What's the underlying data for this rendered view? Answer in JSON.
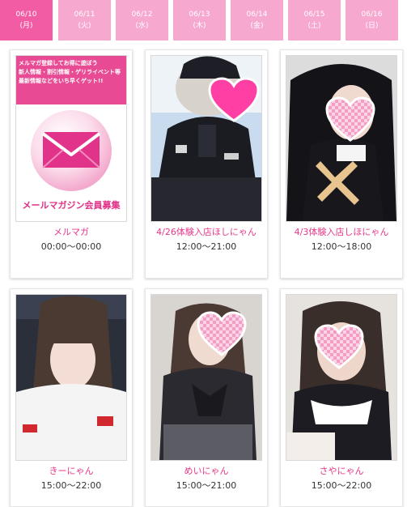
{
  "schedule_tabs": [
    {
      "date": "06/10",
      "weekday": "(月)"
    },
    {
      "date": "06/11",
      "weekday": "(火)"
    },
    {
      "date": "06/12",
      "weekday": "(水)"
    },
    {
      "date": "06/13",
      "weekday": "(木)"
    },
    {
      "date": "06/14",
      "weekday": "(金)"
    },
    {
      "date": "06/15",
      "weekday": "(土)"
    },
    {
      "date": "06/16",
      "weekday": "(日)"
    }
  ],
  "active_tab": "06/10",
  "banner": {
    "line1": "メルマガ登録してお得に遊ぼう",
    "line2": "新人情報・割引情報・ゲリライベント等",
    "line3": "最新情報などをいち早くゲット!!",
    "footer": "メールマガジン会員募集"
  },
  "cards": [
    {
      "name": "メルマガ",
      "time": "00:00〜00:00",
      "image": "mail-magazine-banner"
    },
    {
      "name": "4/26体験入店ほしにゃん",
      "time": "12:00〜21:00",
      "image": "photo-police-costume"
    },
    {
      "name": "4/3体験入店しほにゃん",
      "time": "12:00〜18:00",
      "image": "photo-nun-costume"
    },
    {
      "name": "きーにゃん",
      "time": "15:00〜22:00",
      "image": "photo-white-jacket"
    },
    {
      "name": "めいにゃん",
      "time": "15:00〜21:00",
      "image": "photo-school-uniform"
    },
    {
      "name": "さやにゃん",
      "time": "15:00〜22:00",
      "image": "photo-maid-costume"
    }
  ],
  "colors": {
    "tab_active": "#f25ca4",
    "tab_inactive": "#f7a8cf",
    "name_text": "#e8388a",
    "time_text": "#333333"
  }
}
